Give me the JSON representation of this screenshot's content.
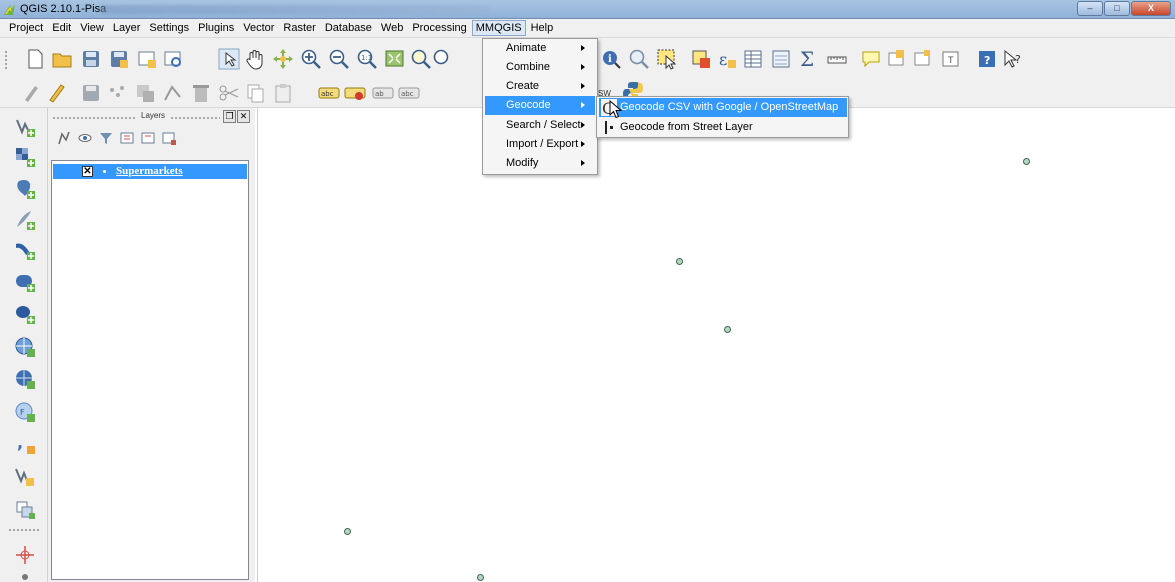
{
  "window": {
    "title": "QGIS 2.10.1-Pisa",
    "controls": {
      "minimize": "–",
      "maximize": "□",
      "close": "X"
    }
  },
  "menubar": {
    "items": [
      "Project",
      "Edit",
      "View",
      "Layer",
      "Settings",
      "Plugins",
      "Vector",
      "Raster",
      "Database",
      "Web",
      "Processing",
      "MMQGIS",
      "Help"
    ],
    "active": "MMQGIS"
  },
  "mmqgis_menu": {
    "items": [
      {
        "label": "Animate",
        "submenu": true
      },
      {
        "label": "Combine",
        "submenu": true
      },
      {
        "label": "Create",
        "submenu": true
      },
      {
        "label": "Geocode",
        "submenu": true,
        "highlighted": true
      },
      {
        "label": "Search / Select",
        "submenu": true
      },
      {
        "label": "Import / Export",
        "submenu": true
      },
      {
        "label": "Modify",
        "submenu": true
      }
    ]
  },
  "geocode_submenu": {
    "items": [
      {
        "label": "Geocode CSV with Google / OpenStreetMap",
        "icon": "google-g-icon",
        "highlighted": true
      },
      {
        "label": "Geocode from Street Layer",
        "icon": "street-geocode-icon"
      }
    ]
  },
  "layers_panel": {
    "title": "Layers",
    "layers": [
      {
        "name": "Supermarkets",
        "checked": true,
        "selected": true
      }
    ]
  },
  "toolbar": {
    "partial_label": "SW"
  },
  "colors": {
    "selection": "#3399ff",
    "point_fill": "#b7d3c3",
    "point_stroke": "#3d6a52"
  }
}
